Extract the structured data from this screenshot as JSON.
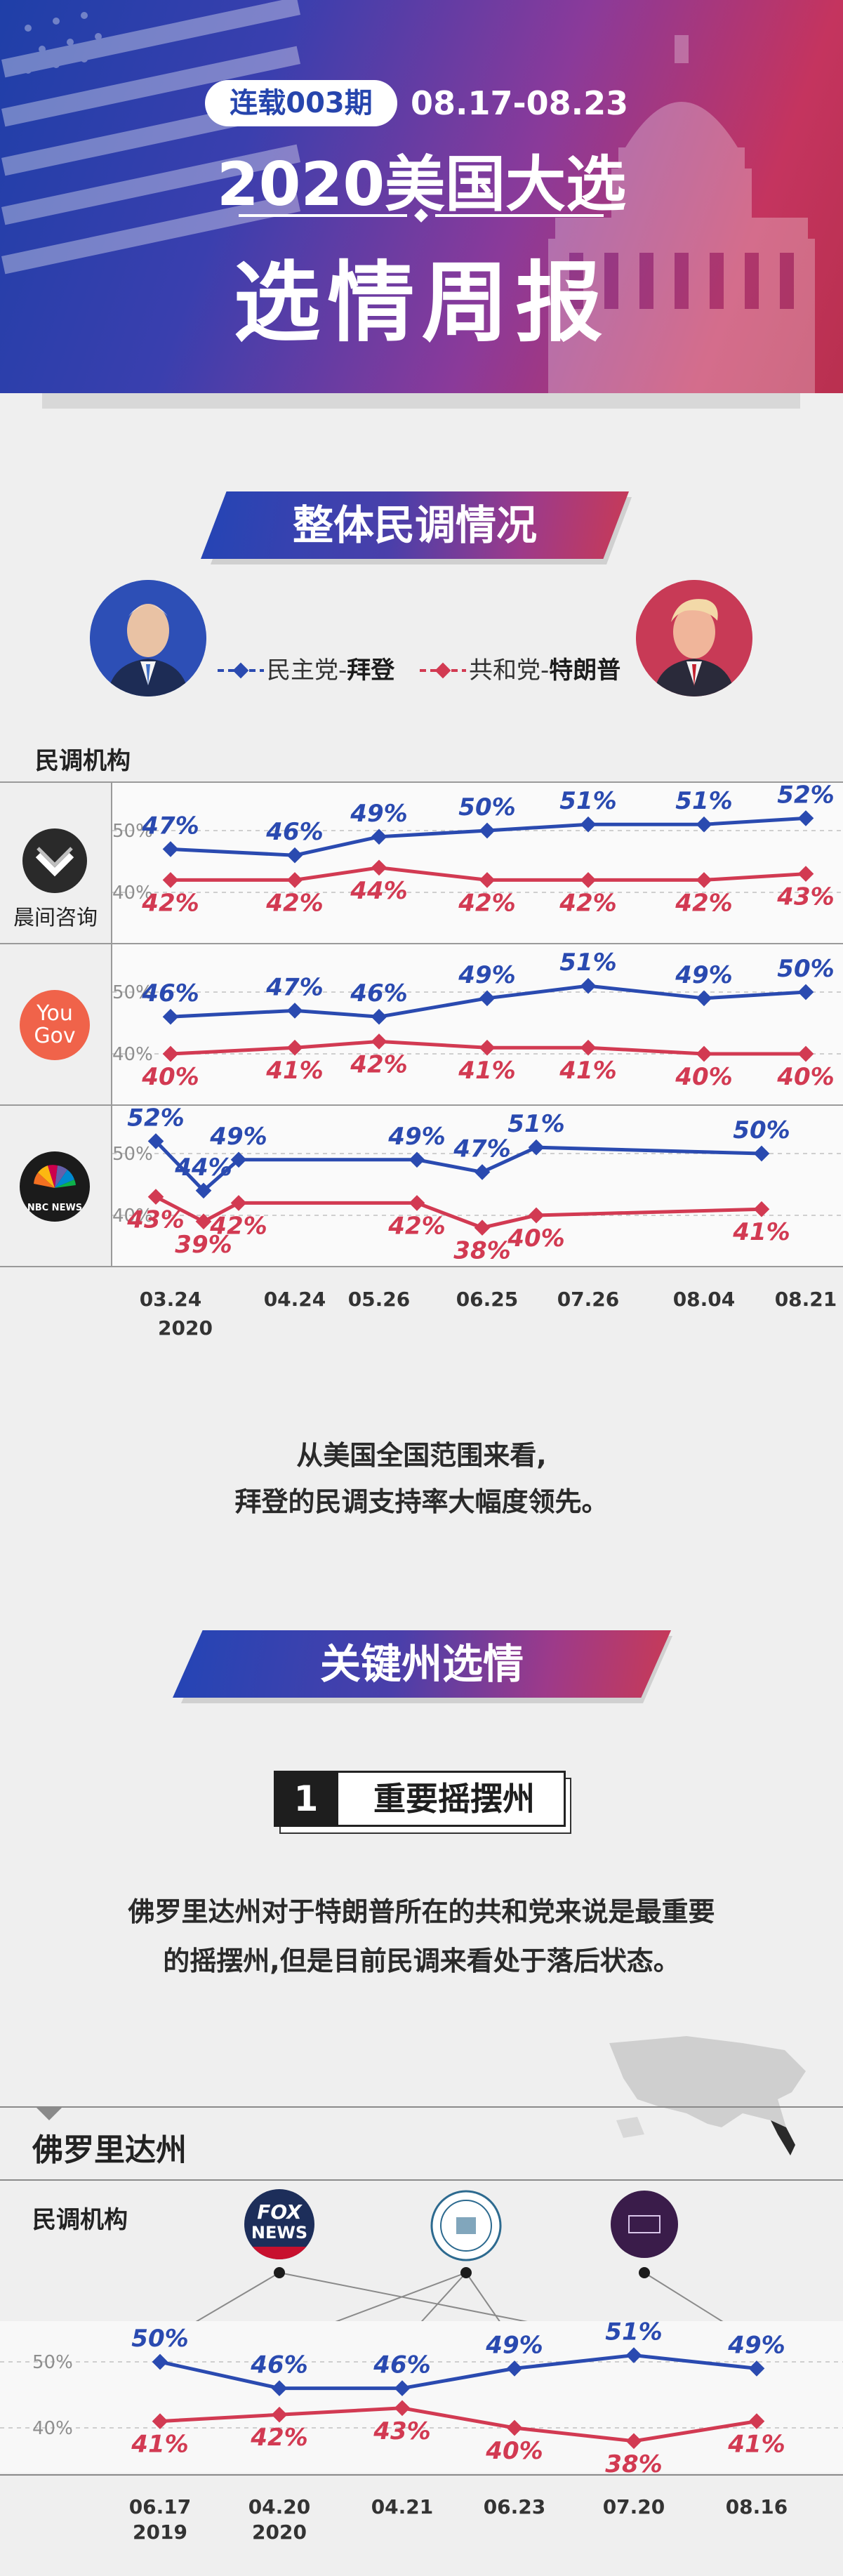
{
  "header": {
    "issue_label": "连载003期",
    "date_range": "08.17-08.23",
    "title": "2020美国大选",
    "subtitle": "选情周报"
  },
  "section1": {
    "banner": "整体民调情况",
    "legend": {
      "dem_prefix": "民主党-",
      "dem_name": "拜登",
      "rep_prefix": "共和党-",
      "rep_name": "特朗普"
    },
    "org_header": "民调机构",
    "orgs": [
      {
        "name": "晨间咨询",
        "logo": "morning-consult-logo"
      },
      {
        "name": "YouGov",
        "logo_line1": "You",
        "logo_line2": "Gov"
      },
      {
        "name": "NBC NEWS",
        "logo": "nbc-peacock-logo"
      }
    ],
    "axis_year": "2020",
    "summary": [
      "从美国全国范围来看,",
      "拜登的民调支持率大幅度领先。"
    ]
  },
  "section2": {
    "banner": "关键州选情",
    "tag_number": "1",
    "tag_label": "重要摇摆州",
    "summary": [
      "佛罗里达州对于特朗普所在的共和党来说是最重要",
      "的摇摆州,但是目前民调来看处于落后状态。"
    ],
    "state_name": "佛罗里达州",
    "org_header": "民调机构",
    "fox_line1": "FOX",
    "fox_line2": "NEWS"
  },
  "chart_data": [
    {
      "type": "line",
      "title": "晨间咨询",
      "x": [
        "03.24",
        "04.24",
        "05.26",
        "06.25",
        "07.26",
        "08.04",
        "08.21"
      ],
      "yticks": [
        "50%",
        "40%"
      ],
      "series": [
        {
          "name": "民主党-拜登",
          "color": "#2a4ab0",
          "values": [
            47,
            46,
            49,
            50,
            51,
            51,
            52
          ]
        },
        {
          "name": "共和党-特朗普",
          "color": "#d23a52",
          "values": [
            42,
            42,
            44,
            42,
            42,
            42,
            43
          ]
        }
      ]
    },
    {
      "type": "line",
      "title": "YouGov",
      "x": [
        "03.24",
        "04.24",
        "05.26",
        "06.25",
        "07.26",
        "08.04",
        "08.21"
      ],
      "yticks": [
        "50%",
        "40%"
      ],
      "series": [
        {
          "name": "民主党-拜登",
          "color": "#2a4ab0",
          "values": [
            46,
            47,
            46,
            49,
            51,
            49,
            50
          ]
        },
        {
          "name": "共和党-特朗普",
          "color": "#d23a52",
          "values": [
            40,
            41,
            42,
            41,
            41,
            40,
            40
          ]
        }
      ]
    },
    {
      "type": "line",
      "title": "NBC NEWS",
      "x": [
        "03.24",
        "04.24",
        "05.26",
        "06.25",
        "07.26",
        "08.04",
        "08.21"
      ],
      "yticks": [
        "50%",
        "40%"
      ],
      "series": [
        {
          "name": "民主党-拜登",
          "color": "#2a4ab0",
          "values": [
            52,
            44,
            49,
            49,
            47,
            51,
            50
          ]
        },
        {
          "name": "共和党-特朗普",
          "color": "#d23a52",
          "values": [
            43,
            39,
            42,
            42,
            38,
            40,
            41
          ]
        }
      ]
    },
    {
      "type": "line",
      "title": "佛罗里达州",
      "x": [
        "06.17",
        "04.20",
        "04.21",
        "06.23",
        "07.20",
        "08.16"
      ],
      "x_years": [
        "2019",
        "2020",
        "",
        "",
        "",
        ""
      ],
      "yticks": [
        "50%",
        "40%"
      ],
      "series": [
        {
          "name": "民主党-拜登",
          "color": "#2a4ab0",
          "values": [
            50,
            46,
            46,
            49,
            51,
            49
          ]
        },
        {
          "name": "共和党-特朗普",
          "color": "#d23a52",
          "values": [
            41,
            42,
            43,
            40,
            38,
            41
          ]
        }
      ]
    }
  ]
}
